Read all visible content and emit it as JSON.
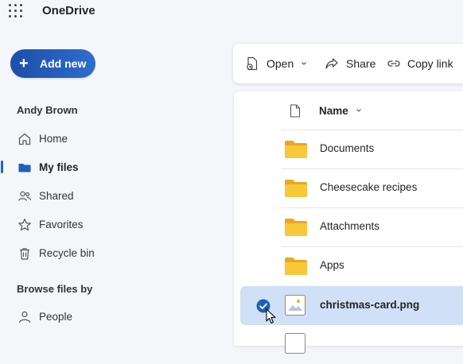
{
  "app": {
    "title": "OneDrive"
  },
  "sidebar": {
    "add_new_label": "Add new",
    "user_name": "Andy Brown",
    "items": [
      {
        "label": "Home",
        "icon": "home-icon"
      },
      {
        "label": "My files",
        "icon": "folder-icon",
        "active": true
      },
      {
        "label": "Shared",
        "icon": "people-icon"
      },
      {
        "label": "Favorites",
        "icon": "star-icon"
      },
      {
        "label": "Recycle bin",
        "icon": "trash-icon"
      }
    ],
    "browse_heading": "Browse files by",
    "browse_items": [
      {
        "label": "People",
        "icon": "person-icon"
      }
    ]
  },
  "toolbar": {
    "open_label": "Open",
    "share_label": "Share",
    "copy_link_label": "Copy link"
  },
  "file_list": {
    "name_header": "Name",
    "rows": [
      {
        "name": "Documents",
        "type": "folder"
      },
      {
        "name": "Cheesecake recipes",
        "type": "folder"
      },
      {
        "name": "Attachments",
        "type": "folder"
      },
      {
        "name": "Apps",
        "type": "folder"
      },
      {
        "name": "christmas-card.png",
        "type": "image",
        "selected": true
      }
    ]
  },
  "colors": {
    "accent": "#2062c8",
    "folder": "#f5c02d",
    "selected_row": "#cfe0f7"
  }
}
